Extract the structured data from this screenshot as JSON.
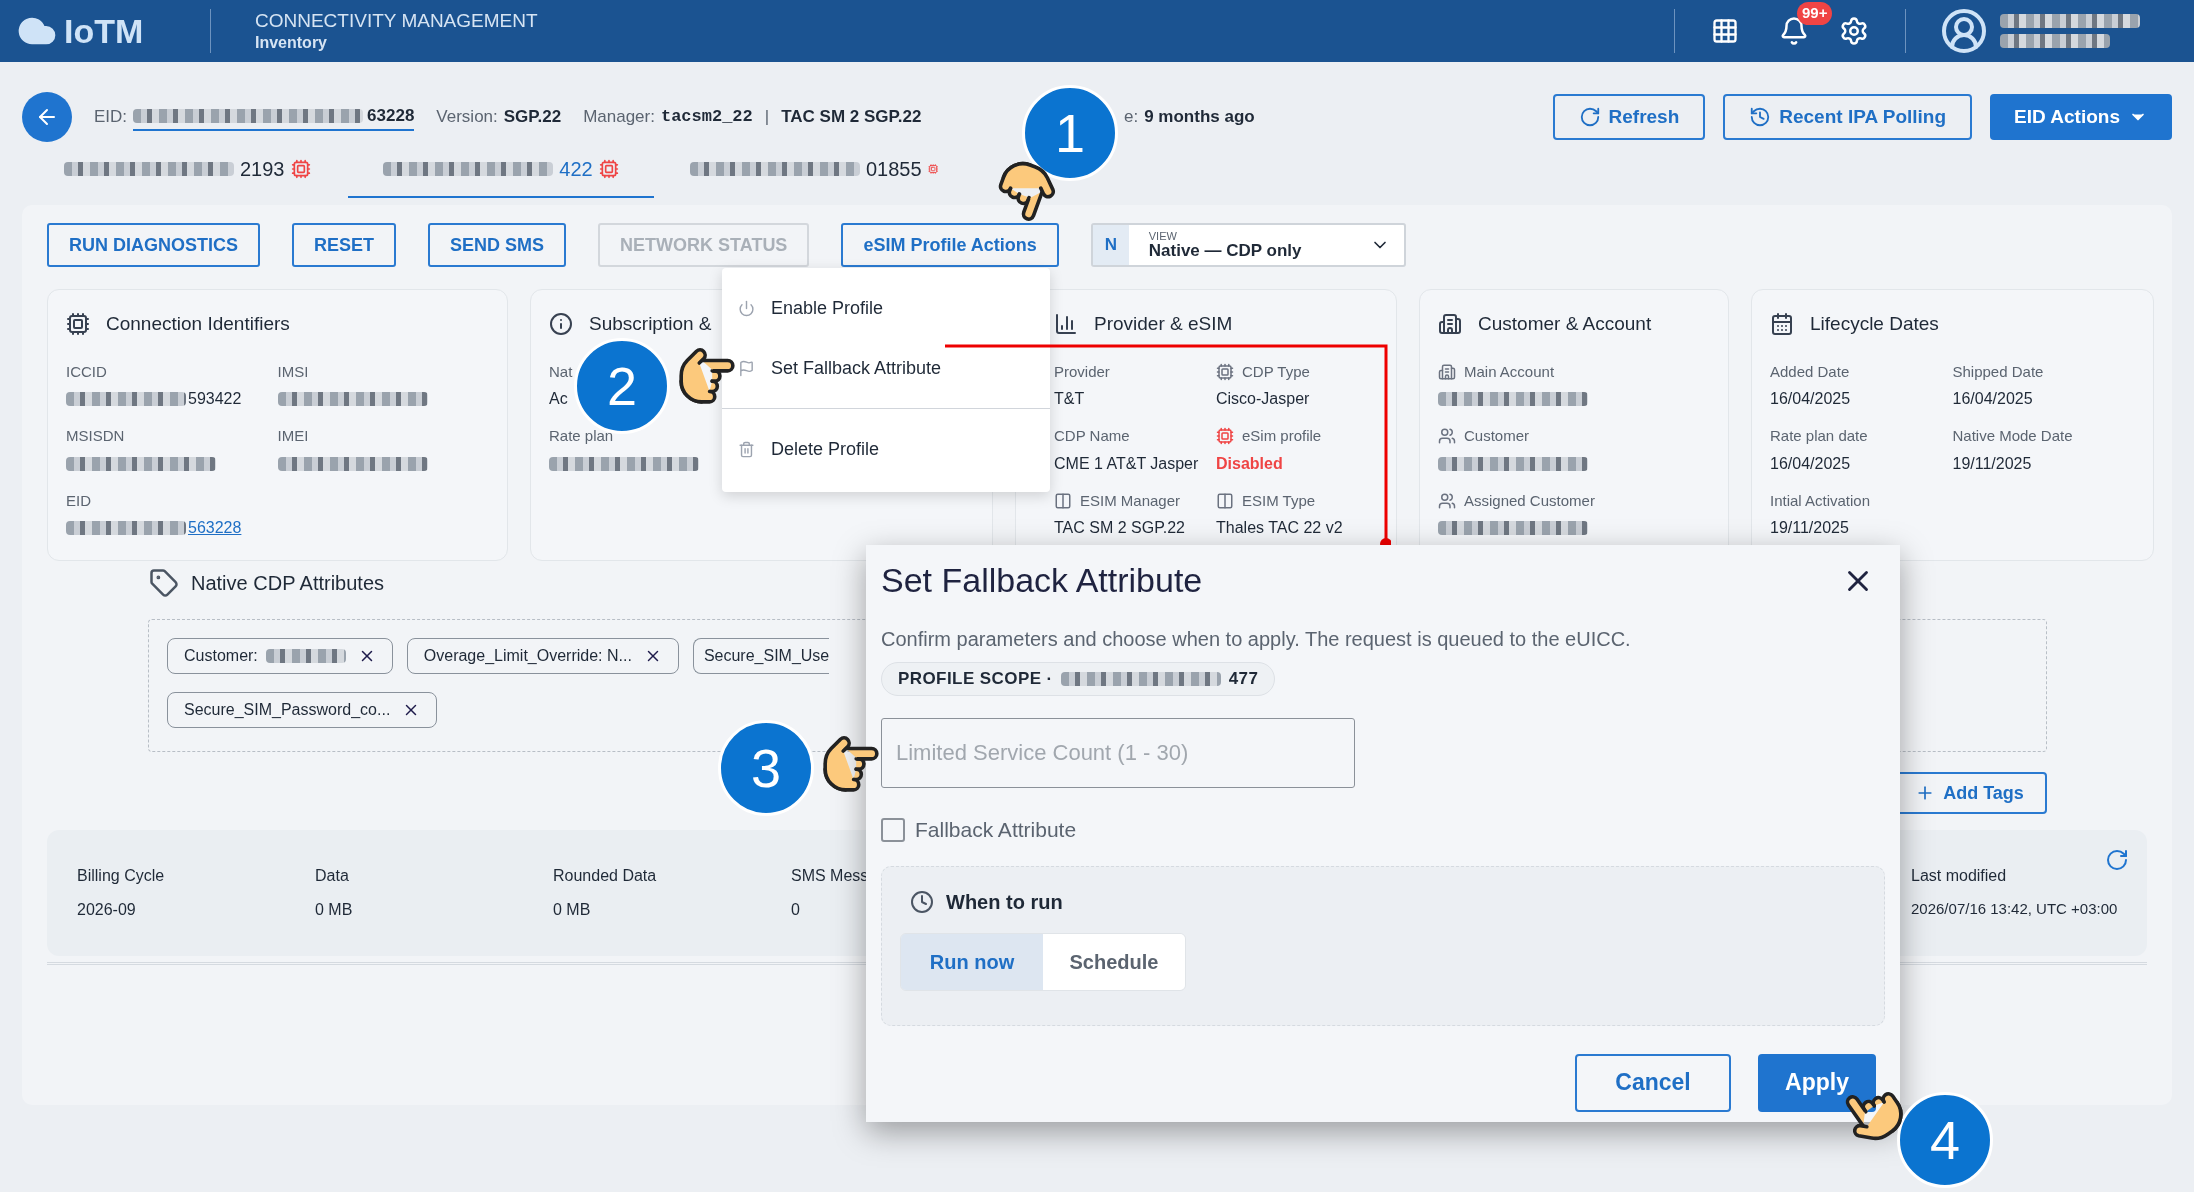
{
  "header": {
    "app_name": "IoTM",
    "title": "CONNECTIVITY MANAGEMENT",
    "subtitle": "Inventory",
    "notification_badge": "99+"
  },
  "summary": {
    "eid": {
      "label": "EID:",
      "value": "63228"
    },
    "version": {
      "label": "Version:",
      "value": "SGP.22"
    },
    "manager": {
      "label": "Manager:",
      "value": "tacsm2_22",
      "separator": "|",
      "detail": "TAC SM 2 SGP.22"
    },
    "age": {
      "label": "e:",
      "value": "9 months ago"
    }
  },
  "header_actions": [
    {
      "label": "Refresh",
      "kind": "refresh"
    },
    {
      "label": "Recent IPA Polling",
      "kind": "history"
    },
    {
      "label": "EID Actions",
      "kind": "menu"
    }
  ],
  "profile_tabs": [
    {
      "value": "2193",
      "selected": false
    },
    {
      "value": "422",
      "selected": true
    },
    {
      "value": "01855",
      "selected": false
    }
  ],
  "actions": [
    {
      "label": "RUN DIAGNOSTICS",
      "disabled": false
    },
    {
      "label": "RESET",
      "disabled": false
    },
    {
      "label": "SEND SMS",
      "disabled": false
    },
    {
      "label": "NETWORK STATUS",
      "disabled": true
    },
    {
      "label": "eSIM Profile Actions",
      "disabled": false
    }
  ],
  "view_select": {
    "badge": "N",
    "label": "VIEW",
    "value": "Native — CDP only"
  },
  "cards": [
    {
      "title": "Connection Identifiers",
      "fields": [
        {
          "label": "ICCID",
          "value": "593422",
          "redacted": true
        },
        {
          "label": "IMSI",
          "redacted": true
        },
        {
          "label": "MSISDN",
          "redacted": true
        },
        {
          "label": "IMEI",
          "redacted": true
        },
        {
          "label": "EID",
          "value": "563228",
          "redacted": true,
          "kind": "link"
        }
      ]
    },
    {
      "title": "Subscription &",
      "fields": [
        {
          "label": "Nat",
          "value": "Ac"
        },
        {
          "label": "Rate plan",
          "redacted": true
        }
      ]
    },
    {
      "title": "Provider & eSIM",
      "fields": [
        {
          "label": "Provider",
          "value": "T&T"
        },
        {
          "label": "CDP Type",
          "value": "Cisco-Jasper"
        },
        {
          "label": "CDP Name",
          "value": "CME 1 AT&T Jasper"
        },
        {
          "label": "eSim profile",
          "value": "Disabled",
          "kind": "danger"
        },
        {
          "label": "ESIM Manager",
          "value": "TAC SM 2 SGP.22"
        },
        {
          "label": "ESIM Type",
          "value": "Thales TAC 22 v2"
        }
      ]
    },
    {
      "title": "Customer & Account",
      "fields": [
        {
          "label": "Main Account",
          "redacted": true
        },
        {
          "label": "Customer",
          "redacted": true
        },
        {
          "label": "Assigned Customer",
          "redacted": true
        }
      ]
    },
    {
      "title": "Lifecycle Dates",
      "fields": [
        {
          "label": "Added Date",
          "value": "16/04/2025"
        },
        {
          "label": "Shipped Date",
          "value": "16/04/2025"
        },
        {
          "label": "Rate plan date",
          "value": "16/04/2025"
        },
        {
          "label": "Native Mode Date",
          "value": "19/11/2025"
        },
        {
          "label": "Intial Activation",
          "value": "19/11/2025"
        }
      ]
    }
  ],
  "attributes": {
    "title": "Native CDP Attributes",
    "tags": [
      {
        "label": "Customer:",
        "redacted": true,
        "closable": true
      },
      {
        "label": "Overage_Limit_Override: N...",
        "closable": true
      },
      {
        "label": "Secure_SIM_Use",
        "closable": false
      },
      {
        "label": "Secure_SIM_Password_co...",
        "closable": true
      }
    ],
    "add_label": "Add Tags"
  },
  "usage": {
    "columns": [
      {
        "label": "Billing Cycle",
        "value": "2026-09"
      },
      {
        "label": "Data",
        "value": "0 MB"
      },
      {
        "label": "Rounded Data",
        "value": "0 MB"
      },
      {
        "label": "SMS Mess",
        "value": "0"
      }
    ],
    "last_modified": {
      "label": "Last modified",
      "value": "2026/07/16 13:42, UTC +03:00"
    }
  },
  "menu": {
    "items": [
      {
        "label": "Enable Profile",
        "kind": "power",
        "divider_before": false
      },
      {
        "label": "Set Fallback Attribute",
        "kind": "flag",
        "divider_before": false
      },
      {
        "label": "Delete Profile",
        "kind": "trash",
        "divider_before": true
      }
    ]
  },
  "dialog": {
    "title": "Set Fallback Attribute",
    "description": "Confirm parameters and choose when to apply. The request is queued to the eUICC.",
    "scope_label": "PROFILE SCOPE ·",
    "scope_value": "477",
    "input_placeholder": "Limited Service Count (1 - 30)",
    "checkbox": {
      "label": "Fallback Attribute",
      "checked": false
    },
    "schedule": {
      "title": "When to run",
      "options": [
        {
          "label": "Run now",
          "selected": true
        },
        {
          "label": "Schedule",
          "selected": false
        }
      ]
    },
    "buttons": [
      {
        "label": "Cancel",
        "kind": "secondary"
      },
      {
        "label": "Apply",
        "kind": "primary"
      }
    ]
  },
  "steps": [
    "1",
    "2",
    "3",
    "4"
  ]
}
